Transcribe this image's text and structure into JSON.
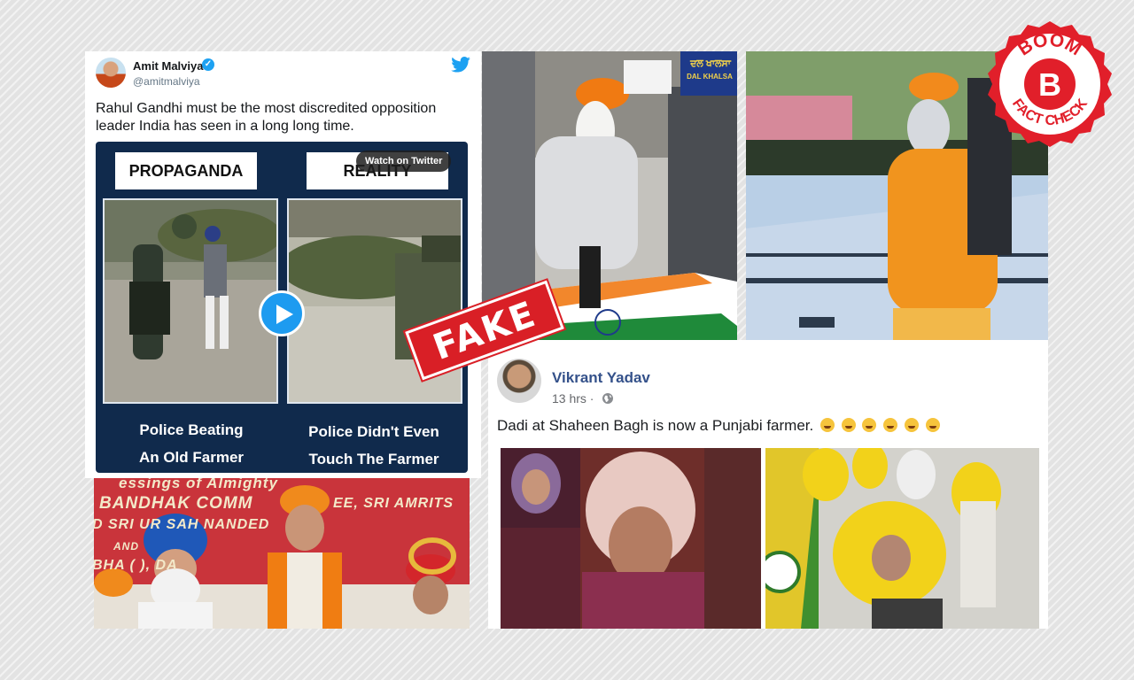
{
  "tweet": {
    "author_name": "Amit Malviya",
    "author_handle": "@amitmalviya",
    "text": "Rahul Gandhi must be the most discredited opposition leader India has seen in a long long time.",
    "video": {
      "left_label": "PROPAGANDA",
      "right_label": "REALITY",
      "watch_button": "Watch on Twitter",
      "left_caption_line1": "Police Beating",
      "left_caption_line2": "An Old Farmer",
      "right_caption_line1": "Police Didn't Even",
      "right_caption_line2": "Touch The Farmer"
    }
  },
  "photos": {
    "gurdwara_banner_line1": "essings of Almighty",
    "gurdwara_banner_line2": "BANDHAK COMM",
    "gurdwara_banner_line3": "EE, SRI AMRITS",
    "gurdwara_banner_line4": "D SRI  UR SAH  NANDED",
    "gurdwara_banner_line5": "AND",
    "gurdwara_banner_line6": "BHA (   ), DA",
    "flag_placard": "ਦਲ ਖਾਲਸਾ",
    "flag_placard_sub": "DAL KHALSA"
  },
  "facebook_post": {
    "author_name": "Vikrant Yadav",
    "time": "13 hrs ·",
    "text": "Dadi at Shaheen Bagh is now a Punjabi farmer."
  },
  "stamp": {
    "text": "FAKE"
  },
  "badge": {
    "top": "BOOM",
    "letter": "B",
    "bottom": "FACT CHECK"
  },
  "colors": {
    "twitter_blue": "#1da1f2",
    "stamp_red": "#d91f26",
    "facebook_name": "#34518a",
    "video_bg": "#102a4c"
  }
}
